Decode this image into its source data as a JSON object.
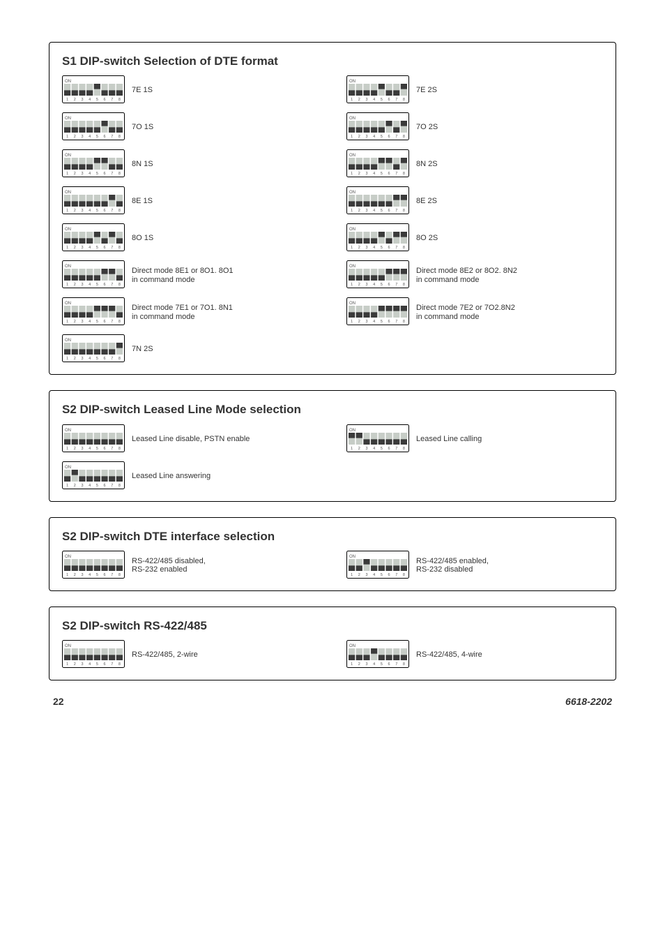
{
  "panels": [
    {
      "title": "S1 DIP-switch\nSelection of DTE format",
      "left": [
        {
          "label": "7E 1S",
          "sw": [
            0,
            0,
            0,
            0,
            1,
            0,
            0,
            0
          ]
        },
        {
          "label": "7O 1S",
          "sw": [
            0,
            0,
            0,
            0,
            0,
            1,
            0,
            0
          ]
        },
        {
          "label": "8N 1S",
          "sw": [
            0,
            0,
            0,
            0,
            1,
            1,
            0,
            0
          ]
        },
        {
          "label": "8E 1S",
          "sw": [
            0,
            0,
            0,
            0,
            0,
            0,
            1,
            0
          ]
        },
        {
          "label": "8O 1S",
          "sw": [
            0,
            0,
            0,
            0,
            1,
            0,
            1,
            0
          ]
        },
        {
          "label": "Direct mode 8E1 or 8O1. 8O1\nin command mode",
          "sw": [
            0,
            0,
            0,
            0,
            0,
            1,
            1,
            0
          ]
        },
        {
          "label": "Direct mode 7E1 or 7O1. 8N1\nin command mode",
          "sw": [
            0,
            0,
            0,
            0,
            1,
            1,
            1,
            0
          ]
        },
        {
          "label": "7N 2S",
          "sw": [
            0,
            0,
            0,
            0,
            0,
            0,
            0,
            1
          ]
        }
      ],
      "right": [
        {
          "label": "7E 2S",
          "sw": [
            0,
            0,
            0,
            0,
            1,
            0,
            0,
            1
          ]
        },
        {
          "label": "7O 2S",
          "sw": [
            0,
            0,
            0,
            0,
            0,
            1,
            0,
            1
          ]
        },
        {
          "label": "8N 2S",
          "sw": [
            0,
            0,
            0,
            0,
            1,
            1,
            0,
            1
          ]
        },
        {
          "label": "8E 2S",
          "sw": [
            0,
            0,
            0,
            0,
            0,
            0,
            1,
            1
          ]
        },
        {
          "label": "8O 2S",
          "sw": [
            0,
            0,
            0,
            0,
            1,
            0,
            1,
            1
          ]
        },
        {
          "label": "Direct mode 8E2 or 8O2. 8N2\nin command mode",
          "sw": [
            0,
            0,
            0,
            0,
            0,
            1,
            1,
            1
          ]
        },
        {
          "label": "Direct mode 7E2 or 7O2.8N2\nin command mode",
          "sw": [
            0,
            0,
            0,
            0,
            1,
            1,
            1,
            1
          ]
        }
      ]
    },
    {
      "title": "S2 DIP-switch\nLeased Line Mode selection",
      "left": [
        {
          "label": "Leased Line disable, PSTN enable",
          "sw": [
            0,
            0,
            0,
            0,
            0,
            0,
            0,
            0
          ]
        },
        {
          "label": "Leased Line answering",
          "sw": [
            0,
            1,
            0,
            0,
            0,
            0,
            0,
            0
          ]
        }
      ],
      "right": [
        {
          "label": "Leased Line calling",
          "sw": [
            1,
            1,
            0,
            0,
            0,
            0,
            0,
            0
          ]
        }
      ]
    },
    {
      "title": "S2 DIP-switch\nDTE interface selection",
      "left": [
        {
          "label": "RS-422/485 disabled,\nRS-232 enabled",
          "sw": [
            0,
            0,
            0,
            0,
            0,
            0,
            0,
            0
          ]
        }
      ],
      "right": [
        {
          "label": "RS-422/485 enabled,\nRS-232 disabled",
          "sw": [
            0,
            0,
            1,
            0,
            0,
            0,
            0,
            0
          ]
        }
      ]
    },
    {
      "title": "S2 DIP-switch\nRS-422/485",
      "left": [
        {
          "label": "RS-422/485, 2-wire",
          "sw": [
            0,
            0,
            0,
            0,
            0,
            0,
            0,
            0
          ]
        }
      ],
      "right": [
        {
          "label": "RS-422/485, 4-wire",
          "sw": [
            0,
            0,
            0,
            1,
            0,
            0,
            0,
            0
          ]
        }
      ]
    }
  ],
  "footer": {
    "page": "22",
    "docid": "6618-2202"
  },
  "dipVisual": {
    "width": 90,
    "height": 40,
    "onLabel": "ON",
    "numbers": [
      "1",
      "2",
      "3",
      "4",
      "5",
      "6",
      "7",
      "8"
    ],
    "offColor": "#c7cdc7",
    "onColor": "#3a3a3a",
    "borderColor": "#000",
    "textColor": "#555"
  }
}
